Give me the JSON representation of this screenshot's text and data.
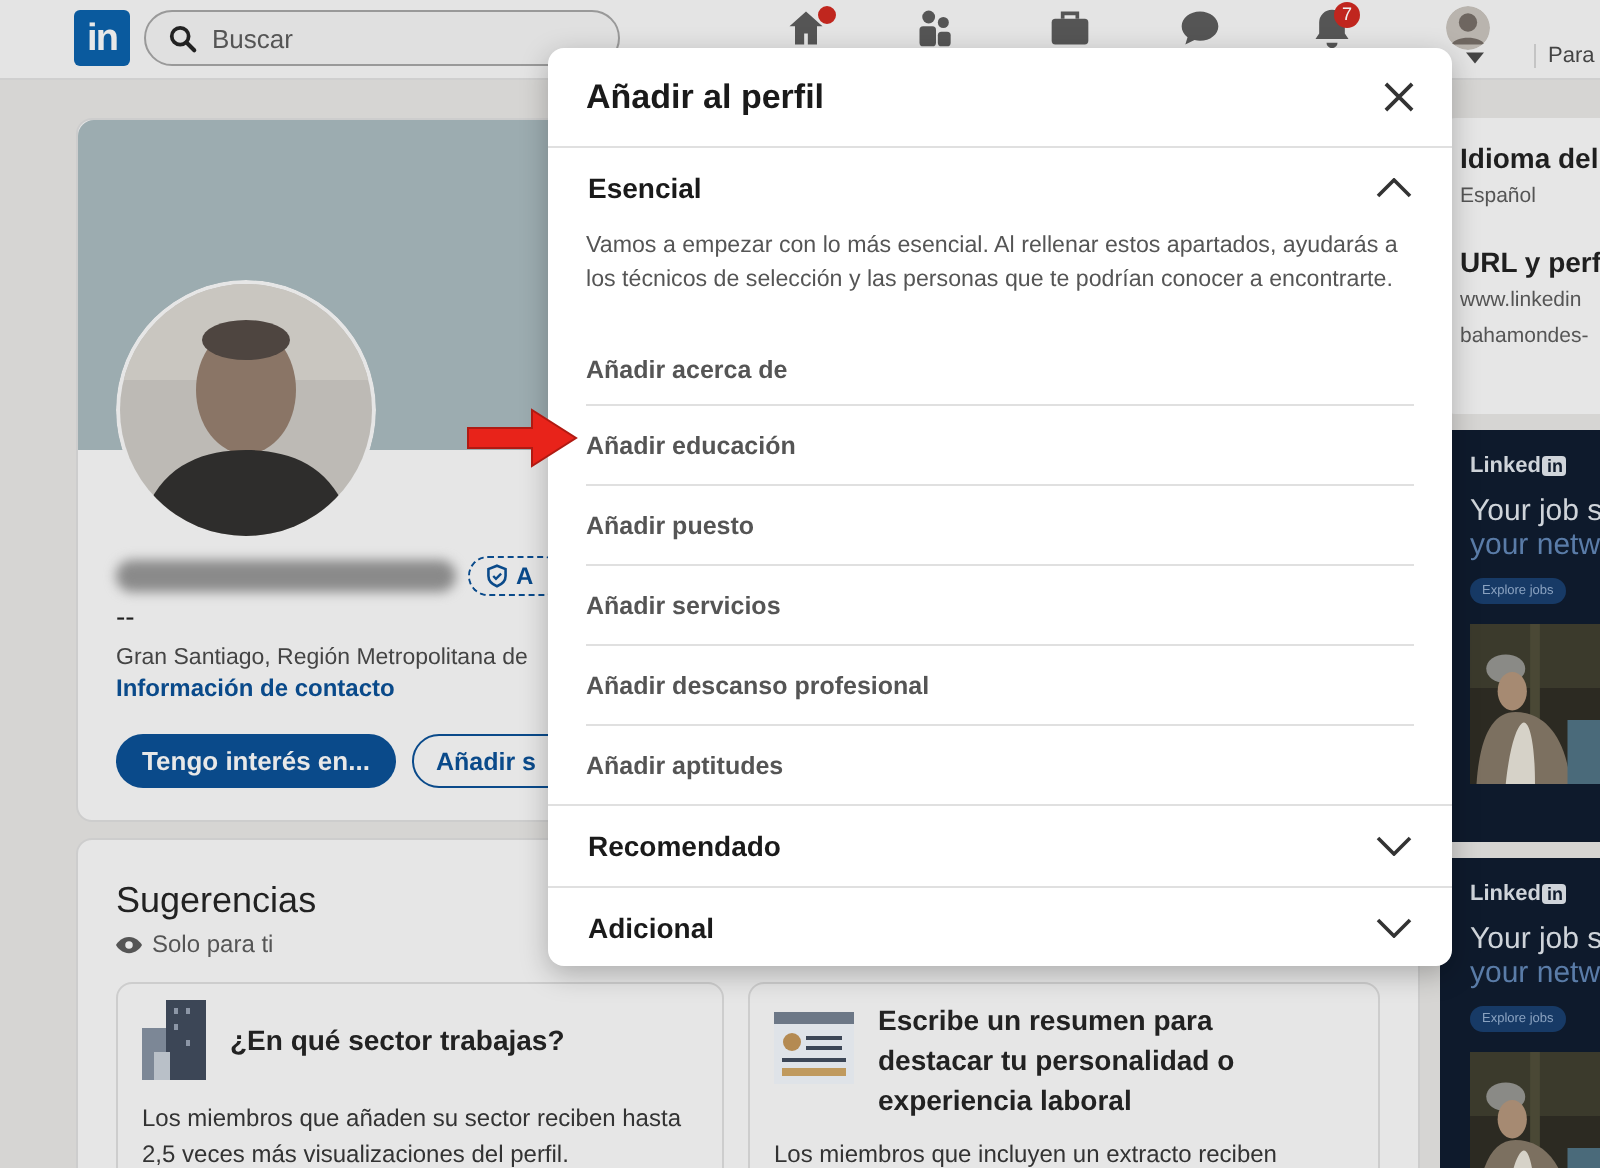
{
  "nav": {
    "logo": "in",
    "search": {
      "placeholder": "Buscar"
    },
    "icons": [
      {
        "kind": "home",
        "dot": true
      },
      {
        "kind": "network",
        "dot": false
      },
      {
        "kind": "jobs",
        "dot": false
      },
      {
        "kind": "messaging",
        "dot": false
      },
      {
        "kind": "notifications",
        "dot": false,
        "badge": "7"
      }
    ],
    "business_label": "Para"
  },
  "profile": {
    "badge": "A",
    "headline": "--",
    "location": "Gran Santiago, Región Metropolitana de",
    "contact_link": "Información de contacto",
    "buttons": [
      {
        "label": "Tengo interés en...",
        "kind": "primary"
      },
      {
        "label": "Añadir s",
        "kind": "secondary"
      }
    ]
  },
  "suggestions": {
    "title": "Sugerencias",
    "visibility": "Solo para ti",
    "cards": [
      {
        "kind": "industry",
        "title": "¿En qué sector trabajas?",
        "body": "Los miembros que añaden su sector reciben hasta 2,5 veces más visualizaciones del perfil."
      },
      {
        "kind": "summary",
        "title": "Escribe un resumen para destacar tu personalidad o experiencia laboral",
        "body": "Los miembros que incluyen un extracto reciben"
      }
    ]
  },
  "sidebar": {
    "sections": [
      {
        "title": "Idioma del",
        "lines": [
          "Español"
        ]
      },
      {
        "title": "URL y perf",
        "lines": [
          "www.linkedin",
          "bahamondes-"
        ]
      }
    ]
  },
  "ads": [
    {
      "logo": "Linked",
      "logo_mark": "in",
      "headline": "Your job s",
      "subline": "your netw",
      "button": "Explore jobs"
    },
    {
      "logo": "Linked",
      "logo_mark": "in",
      "headline": "Your job s",
      "subline": "your netw",
      "button": "Explore jobs"
    }
  ],
  "modal": {
    "title": "Añadir al perfil",
    "sections": [
      {
        "title": "Esencial",
        "expanded": true,
        "description": "Vamos a empezar con lo más esencial. Al rellenar estos apartados, ayudarás a los técnicos de selección y las personas que te podrían conocer a encontrarte.",
        "items": [
          "Añadir acerca de",
          "Añadir educación",
          "Añadir puesto",
          "Añadir servicios",
          "Añadir descanso profesional",
          "Añadir aptitudes"
        ]
      },
      {
        "title": "Recomendado",
        "expanded": false
      },
      {
        "title": "Adicional",
        "expanded": false
      }
    ]
  }
}
